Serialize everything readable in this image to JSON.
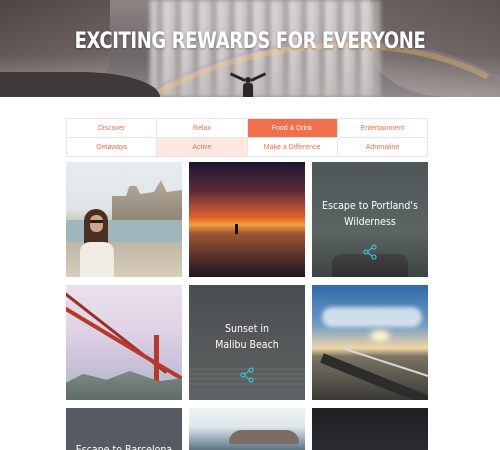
{
  "hero": {
    "title": "EXCITING REWARDS FOR EVERYONE"
  },
  "tabs": [
    {
      "label": "Discover",
      "state": "default"
    },
    {
      "label": "Relax",
      "state": "default"
    },
    {
      "label": "Food & Drink",
      "state": "active"
    },
    {
      "label": "Entertainment",
      "state": "default"
    },
    {
      "label": "Getaways",
      "state": "default"
    },
    {
      "label": "Active",
      "state": "highlight"
    },
    {
      "label": "Make a Difference",
      "state": "default"
    },
    {
      "label": "Adrenaline",
      "state": "default"
    }
  ],
  "cards": {
    "portland": {
      "title_line1": "Escape to Portland's",
      "title_line2": "Wilderness"
    },
    "malibu": {
      "title_line1": "Sunset in",
      "title_line2": "Malibu Beach"
    },
    "barcelona": {
      "title_line1": "Escape to Barcelona"
    }
  },
  "colors": {
    "accent": "#f0704e",
    "accent_text": "#e8704f",
    "highlight_bg": "#fde8e2",
    "share_icon": "#3fb7d0"
  }
}
